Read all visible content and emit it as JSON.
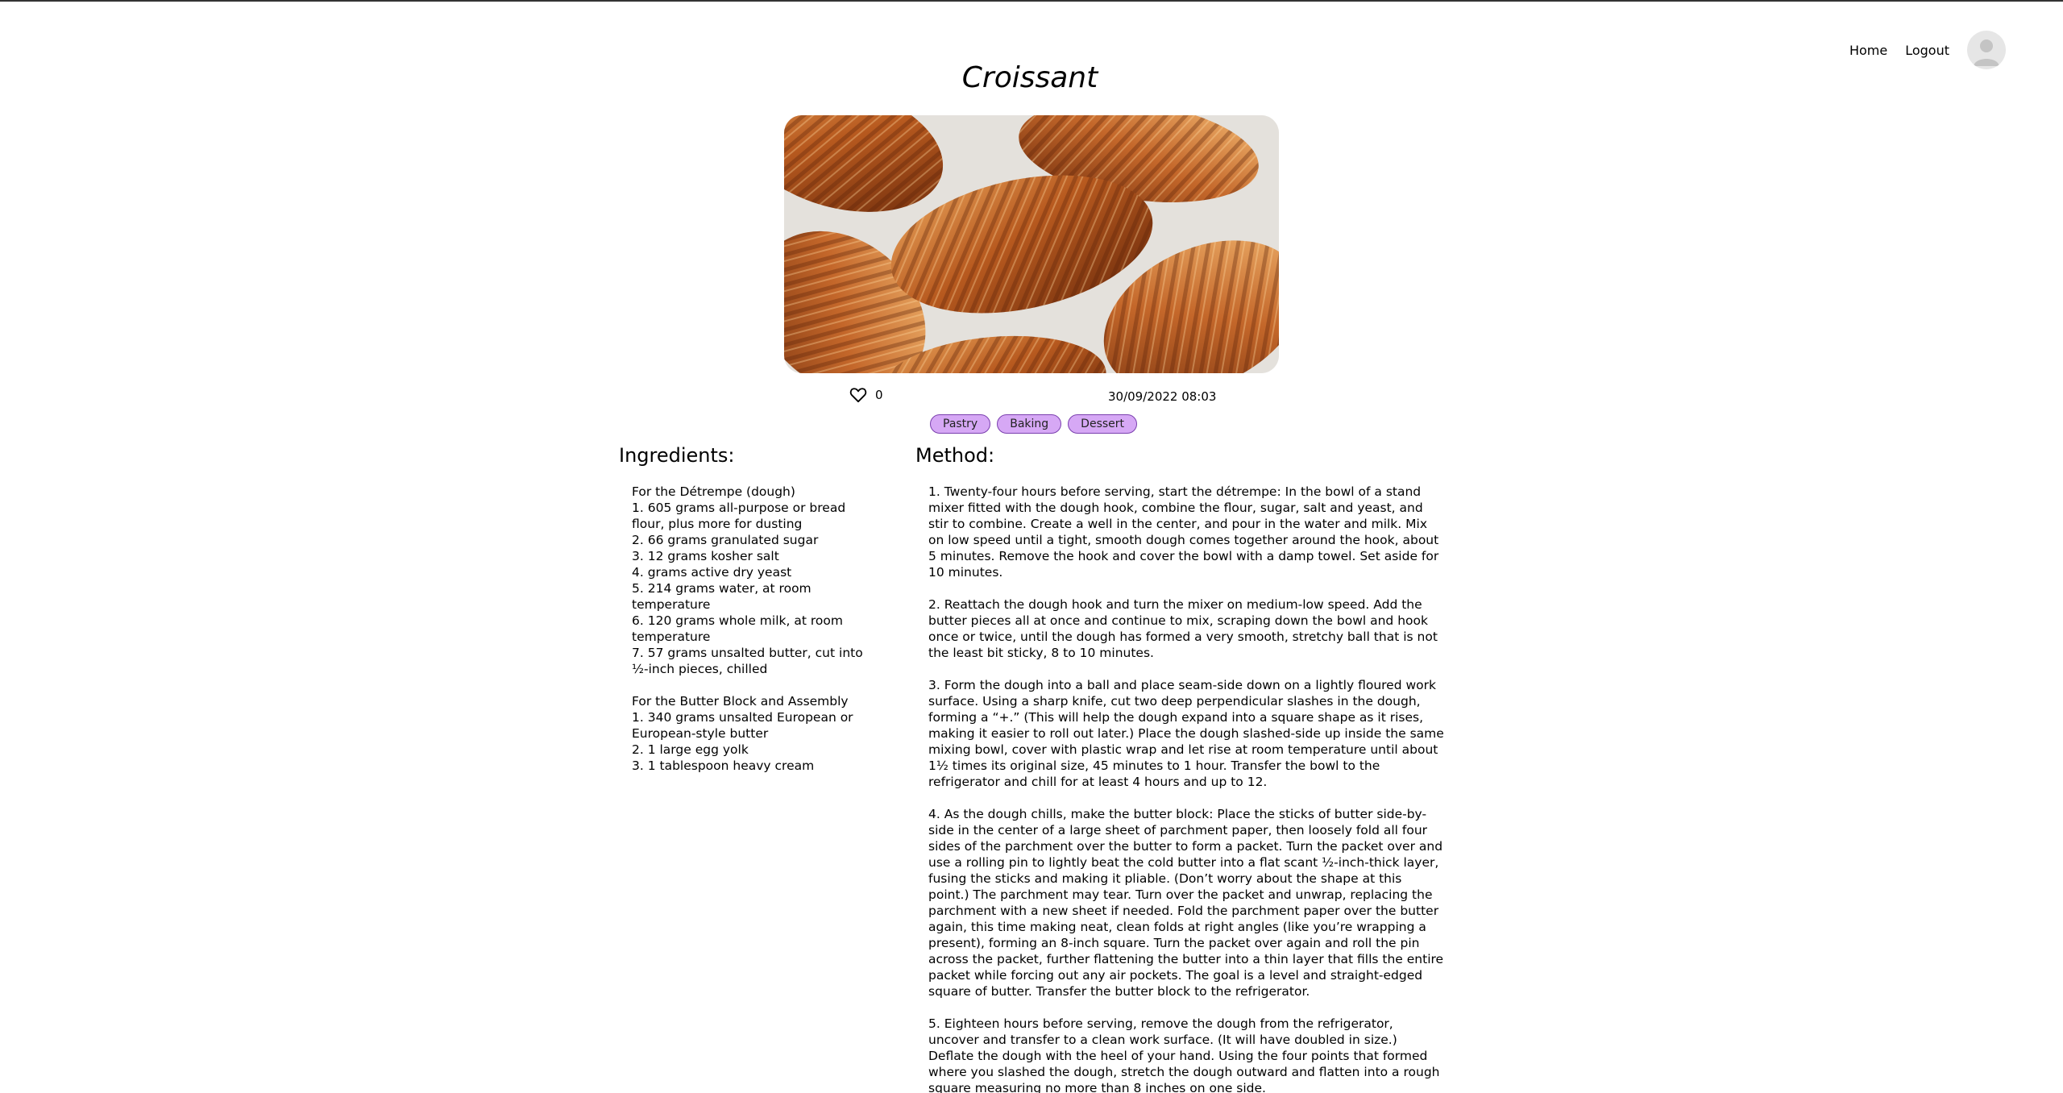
{
  "nav": {
    "home_label": "Home",
    "logout_label": "Logout"
  },
  "recipe": {
    "title": "Croissant",
    "likes": "0",
    "date": "30/09/2022 08:03",
    "tags": [
      "Pastry",
      "Baking",
      "Dessert"
    ]
  },
  "ingredients": {
    "heading": "Ingredients:",
    "lines": [
      "For the Détrempe (dough)",
      "1. 605 grams all-purpose or bread flour, plus more for dusting",
      "2. 66 grams granulated sugar",
      "3. 12 grams kosher salt",
      "4. grams active dry yeast",
      "5. 214 grams water, at room temperature",
      "6. 120 grams whole milk, at room temperature",
      "7. 57 grams unsalted butter, cut into ½-inch pieces, chilled",
      "",
      "For the Butter Block and Assembly",
      "1. 340 grams unsalted European or European-style butter",
      "2. 1 large egg yolk",
      "3. 1 tablespoon heavy cream"
    ]
  },
  "method": {
    "heading": "Method:",
    "steps": [
      "1. Twenty-four hours before serving, start the détrempe: In the bowl of a stand mixer fitted with the dough hook, combine the flour, sugar, salt and yeast, and stir to combine. Create a well in the center, and pour in the water and milk. Mix on low speed until a tight, smooth dough comes together around the hook, about 5 minutes. Remove the hook and cover the bowl with a damp towel. Set aside for 10 minutes.",
      "2. Reattach the dough hook and turn the mixer on medium-low speed. Add the butter pieces all at once and continue to mix, scraping down the bowl and hook once or twice, until the dough has formed a very smooth, stretchy ball that is not the least bit sticky, 8 to 10 minutes.",
      "3. Form the dough into a ball and place seam-side down on a lightly floured work surface. Using a sharp knife, cut two deep perpendicular slashes in the dough, forming a “+.” (This will help the dough expand into a square shape as it rises, making it easier to roll out later.) Place the dough slashed-side up inside the same mixing bowl, cover with plastic wrap and let rise at room temperature until about 1½ times its original size, 45 minutes to 1 hour. Transfer the bowl to the refrigerator and chill for at least 4 hours and up to 12.",
      "4. As the dough chills, make the butter block: Place the sticks of butter side-by-side in the center of a large sheet of parchment paper, then loosely fold all four sides of the parchment over the butter to form a packet. Turn the packet over and use a rolling pin to lightly beat the cold butter into a flat scant ½-inch-thick layer, fusing the sticks and making it pliable. (Don’t worry about the shape at this point.) The parchment may tear. Turn over the packet and unwrap, replacing the parchment with a new sheet if needed. Fold the parchment paper over the butter again, this time making neat, clean folds at right angles (like you’re wrapping a present), forming an 8-inch square. Turn the packet over again and roll the pin across the packet, further flattening the butter into a thin layer that fills the entire packet while forcing out any air pockets. The goal is a level and straight-edged square of butter. Transfer the butter block to the refrigerator.",
      "5. Eighteen hours before serving, remove the dough from the refrigerator, uncover and transfer to a clean work surface. (It will have doubled in size.) Deflate the dough with the heel of your hand. Using the four points that formed where you slashed the dough, stretch the dough outward and flatten into a rough square measuring no more than 8 inches on one side."
    ]
  },
  "icons": {
    "like": "heart-outline-icon",
    "avatar": "user-silhouette-icon"
  },
  "colors": {
    "tag_fill": "#d6a8f5",
    "tag_border": "#7a3fae"
  }
}
